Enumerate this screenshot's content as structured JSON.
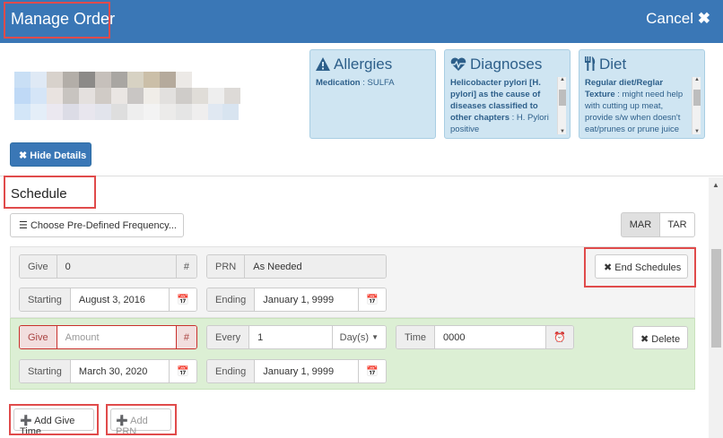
{
  "header": {
    "title": "Manage Order",
    "cancel_label": "Cancel"
  },
  "panels": {
    "allergies": {
      "title": "Allergies",
      "line1_label": "Medication",
      "line1_value": " : SULFA"
    },
    "diagnoses": {
      "title": "Diagnoses",
      "bold": "Helicobacter pylori [H. pylori] as the cause of diseases classified to other chapters",
      "rest": " : H. Pylori positive"
    },
    "diet": {
      "title": "Diet",
      "bold": "Regular diet/Reglar Texture",
      "rest": " : might need help with cutting up meat, provide s/w when doesn't eat/prunes or prune juice"
    }
  },
  "hide_details_label": "Hide Details",
  "schedule": {
    "title": "Schedule",
    "choose_label": "Choose Pre-Defined Frequency...",
    "mar_label": "MAR",
    "tar_label": "TAR",
    "row1": {
      "give_label": "Give",
      "give_value": "0",
      "hash": "#",
      "prn_label": "PRN",
      "prn_value": "As Needed",
      "end_schedules_label": "End Schedules",
      "starting_label": "Starting",
      "starting_value": "August 3, 2016",
      "ending_label": "Ending",
      "ending_value": "January 1, 9999"
    },
    "row2": {
      "give_label": "Give",
      "give_placeholder": "Amount",
      "hash": "#",
      "every_label": "Every",
      "every_value": "1",
      "unit": "Day(s)",
      "time_label": "Time",
      "time_value": "0000",
      "delete_label": "Delete",
      "starting_label": "Starting",
      "starting_value": "March 30, 2020",
      "ending_label": "Ending",
      "ending_value": "January 1, 9999"
    },
    "add_give_time_label": "Add Give Time",
    "add_prn_label": "Add PRN"
  },
  "colors": {
    "header": "#3a77b6",
    "panel": "#cfe5f2",
    "green_row": "#dcefd4",
    "highlight": "#e04b4b"
  }
}
